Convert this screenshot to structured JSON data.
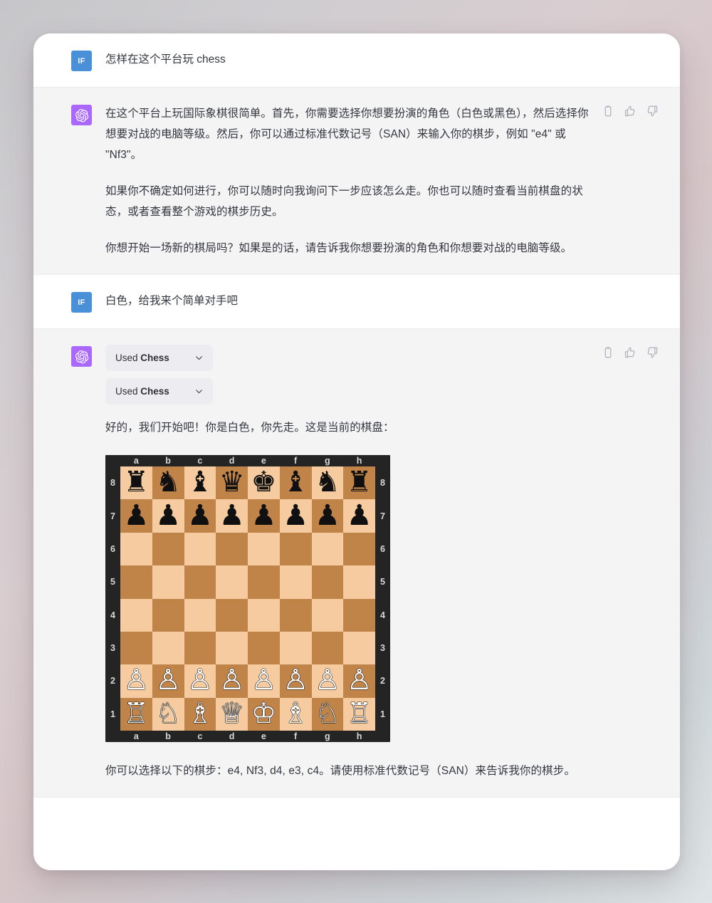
{
  "page": {
    "background_gradient_from": "#c6c6c9",
    "background_gradient_to": "#dfe5e6"
  },
  "avatars": {
    "user_initials": "IF",
    "user_color": "#4a90d9",
    "assistant_icon": "openai-logo-icon",
    "assistant_color": "#ab68ff"
  },
  "actions": {
    "copy_label": "copy-icon",
    "thumbs_up_label": "thumbs-up-icon",
    "thumbs_down_label": "thumbs-down-icon",
    "icon_color": "#aeaeba"
  },
  "messages": [
    {
      "role": "user",
      "text": "怎样在这个平台玩 chess"
    },
    {
      "role": "assistant",
      "paragraphs": [
        "在这个平台上玩国际象棋很简单。首先，你需要选择你想要扮演的角色（白色或黑色），然后选择你想要对战的电脑等级。然后，你可以通过标准代数记号（SAN）来输入你的棋步，例如 \"e4\" 或 \"Nf3\"。",
        "如果你不确定如何进行，你可以随时向我询问下一步应该怎么走。你也可以随时查看当前棋盘的状态，或者查看整个游戏的棋步历史。",
        "你想开始一场新的棋局吗？如果是的话，请告诉我你想要扮演的角色和你想要对战的电脑等级。"
      ]
    },
    {
      "role": "user",
      "text": "白色，给我来个简单对手吧"
    },
    {
      "role": "assistant",
      "tool_pills": [
        {
          "prefix": "Used ",
          "name": "Chess",
          "chevron": "chevron-down-icon"
        },
        {
          "prefix": "Used ",
          "name": "Chess",
          "chevron": "chevron-down-icon"
        }
      ],
      "pre_board_text": "好的，我们开始吧！你是白色，你先走。这是当前的棋盘：",
      "post_board_text": "你可以选择以下的棋步：e4, Nf3, d4, e3, c4。请使用标准代数记号（SAN）来告诉我你的棋步。"
    }
  ],
  "chess_board": {
    "files": [
      "a",
      "b",
      "c",
      "d",
      "e",
      "f",
      "g",
      "h"
    ],
    "ranks": [
      "8",
      "7",
      "6",
      "5",
      "4",
      "3",
      "2",
      "1"
    ],
    "light_square_color": "#f5cb9f",
    "dark_square_color": "#c08348",
    "border_color": "#242424",
    "label_color": "#d8d8d8",
    "position_fen": "rnbqkbnr/pppppppp/8/8/8/8/PPPPPPPP/RNBQKBNR",
    "rows": [
      [
        "r",
        "n",
        "b",
        "q",
        "k",
        "b",
        "n",
        "r"
      ],
      [
        "p",
        "p",
        "p",
        "p",
        "p",
        "p",
        "p",
        "p"
      ],
      [
        "",
        "",
        "",
        "",
        "",
        "",
        "",
        ""
      ],
      [
        "",
        "",
        "",
        "",
        "",
        "",
        "",
        ""
      ],
      [
        "",
        "",
        "",
        "",
        "",
        "",
        "",
        ""
      ],
      [
        "",
        "",
        "",
        "",
        "",
        "",
        "",
        ""
      ],
      [
        "P",
        "P",
        "P",
        "P",
        "P",
        "P",
        "P",
        "P"
      ],
      [
        "R",
        "N",
        "B",
        "Q",
        "K",
        "B",
        "N",
        "R"
      ]
    ]
  },
  "suggested_moves": [
    "e4",
    "Nf3",
    "d4",
    "e3",
    "c4"
  ]
}
